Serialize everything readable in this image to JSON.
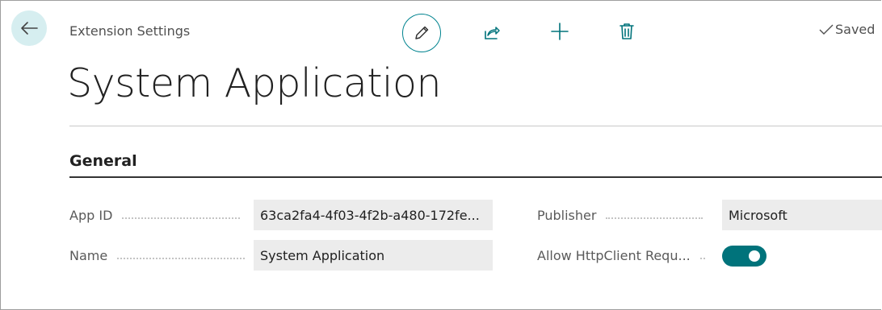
{
  "header": {
    "breadcrumb": "Extension Settings",
    "saved_label": "Saved",
    "accent_color": "#00838f"
  },
  "toolbar": {
    "icons": [
      "back-arrow-icon",
      "pencil-icon",
      "share-icon",
      "plus-icon",
      "trash-icon",
      "checkmark-icon"
    ]
  },
  "page": {
    "title": "System Application"
  },
  "general": {
    "section_title": "General",
    "fields": {
      "app_id": {
        "label": "App ID",
        "value": "63ca2fa4-4f03-4f2b-a480-172fe..."
      },
      "name": {
        "label": "Name",
        "value": "System Application"
      },
      "publisher": {
        "label": "Publisher",
        "value": "Microsoft"
      },
      "allow_http": {
        "label": "Allow HttpClient Requ...",
        "value": true
      }
    }
  }
}
